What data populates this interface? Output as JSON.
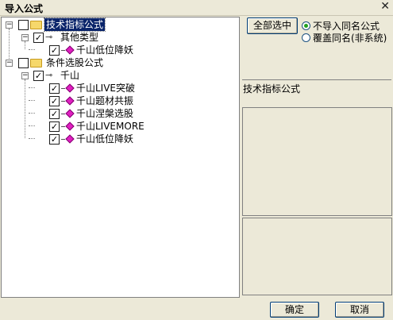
{
  "window": {
    "title": "导入公式",
    "close_glyph": "✕"
  },
  "tree": {
    "group1": {
      "label": "技术指标公式",
      "child": {
        "label": "其他类型",
        "items": [
          "千山低位降妖"
        ]
      }
    },
    "group2": {
      "label": "条件选股公式",
      "child": {
        "label": "千山",
        "items": [
          "千山LIVE突破",
          "千山题材共振",
          "千山涅槃选股",
          "千山LIVEMORE",
          "千山低位降妖"
        ]
      }
    },
    "checked_mark": "✓",
    "expander": "−"
  },
  "buttons": {
    "select_all": "全部选中",
    "ok": "确定",
    "cancel": "取消"
  },
  "options": {
    "no_import_same_name": "不导入同名公式",
    "overwrite_same_name": "覆盖同名(非系统)",
    "selected": "no_import_same_name"
  },
  "info": {
    "type_label": "技术指标公式"
  }
}
